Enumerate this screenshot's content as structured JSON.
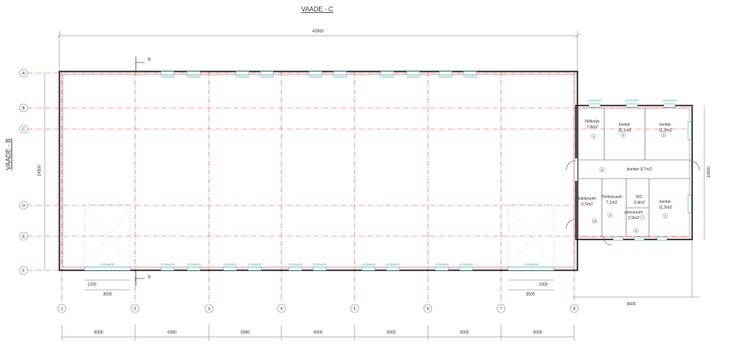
{
  "title": "VAADE - C",
  "side_view_label": "VAADE - B",
  "section_mark": "B",
  "overall_width": "42000",
  "overall_depth": "14500",
  "annex_depth": "10000",
  "annex_width": "9600",
  "row_axes": [
    "A",
    "B",
    "C",
    "D",
    "E",
    "F"
  ],
  "col_axes": [
    "1",
    "2",
    "3",
    "4",
    "5",
    "6",
    "7",
    "8"
  ],
  "bay_spacing": [
    "6000",
    "6000",
    "6000",
    "6000",
    "6000",
    "6000",
    "6000"
  ],
  "left_door_dims": {
    "a": "1200",
    "b": "3500"
  },
  "right_door_dims": {
    "a": "3500",
    "b": "1000"
  },
  "window_tag": "1200x600",
  "rooms": [
    {
      "name": "lõõkoda",
      "area": "7,8m2",
      "num": "5"
    },
    {
      "name": "kontor",
      "area": "11,1m2",
      "num": "4"
    },
    {
      "name": "kontor",
      "area": "11,2m2",
      "num": "3"
    },
    {
      "name": "koridor 8,7m2",
      "area": "",
      "num": "6"
    },
    {
      "name": "katlaruum",
      "area": "6,5m2",
      "num": "10"
    },
    {
      "name": "Puhkeruum",
      "area": "7,1m2",
      "num": "9"
    },
    {
      "name": "kontor",
      "area": "11,5m2",
      "num": "2"
    },
    {
      "name": "WC",
      "area": "3,4m2",
      "num": "7"
    },
    {
      "name": "pesuruum",
      "area": "2,9m2",
      "num": "8"
    }
  ],
  "colors": {
    "grid": "#d84a4a",
    "wall": "#222222",
    "window": "#48a6b8"
  }
}
